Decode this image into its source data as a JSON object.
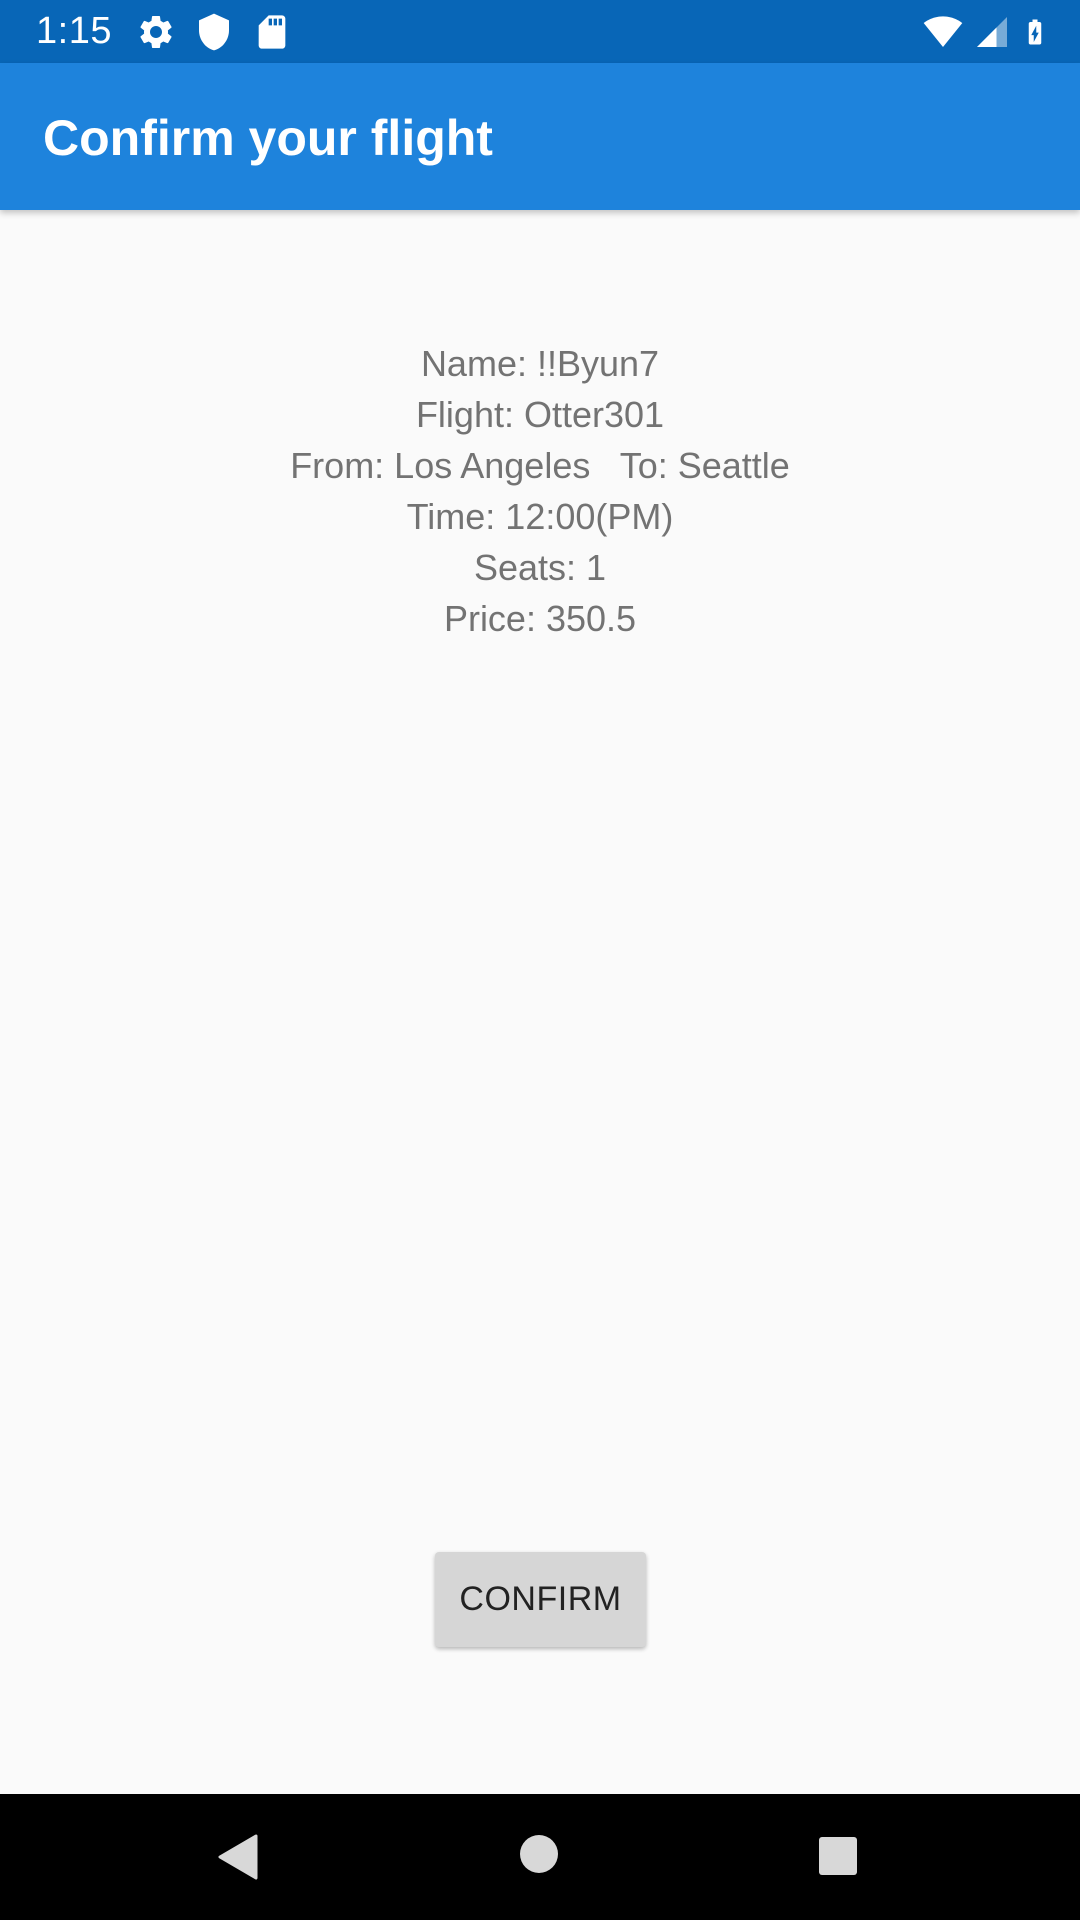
{
  "status_bar": {
    "time": "1:15",
    "left_icons": [
      "settings-icon",
      "shield-icon",
      "sd-card-icon"
    ],
    "right_icons": [
      "wifi-icon",
      "cell-signal-icon",
      "battery-charging-icon"
    ],
    "background": "#0866b7"
  },
  "app_bar": {
    "title": "Confirm your flight",
    "background": "#1e83dc"
  },
  "flight_details": {
    "name": "Name: !!Byun7",
    "flight": "Flight: Otter301",
    "route": "From: Los Angeles   To: Seattle",
    "time": "Time: 12:00(PM)",
    "seats": "Seats: 1",
    "price": "Price: 350.5"
  },
  "actions": {
    "confirm_label": "CONFIRM"
  },
  "nav_bar": {
    "buttons": [
      "back-icon",
      "home-icon",
      "recents-icon"
    ]
  }
}
